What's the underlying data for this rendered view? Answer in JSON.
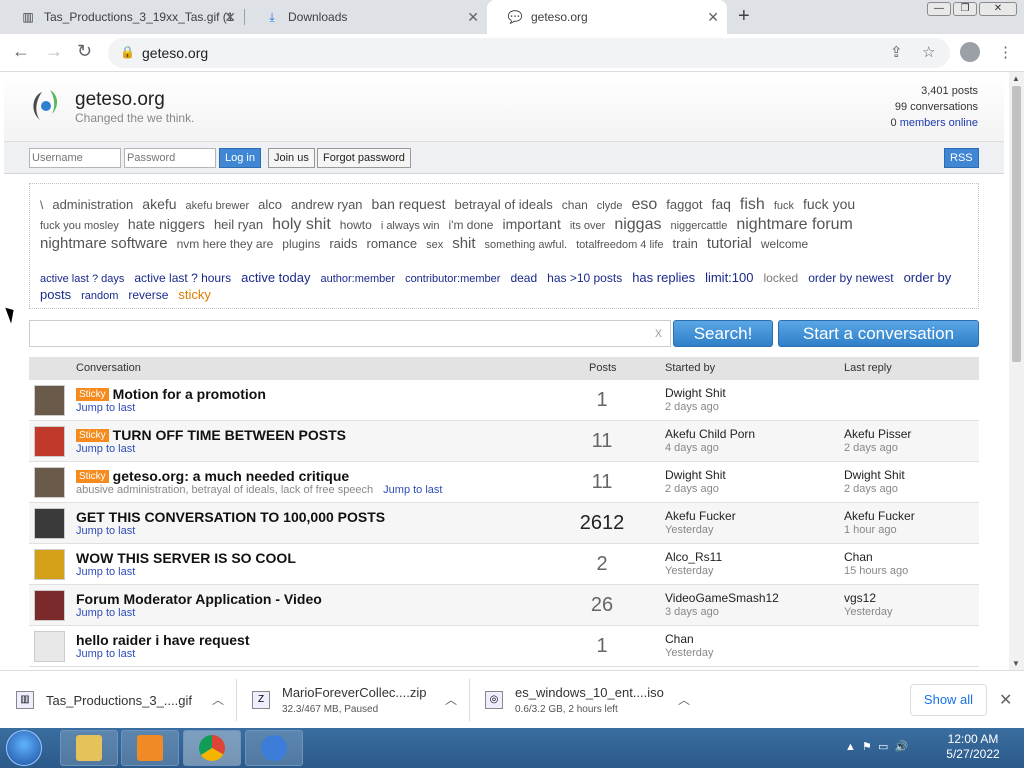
{
  "browser": {
    "tabs": [
      {
        "label": "Tas_Productions_3_19xx_Tas.gif (1",
        "icon": "image-file-icon"
      },
      {
        "label": "Downloads",
        "icon": "download-icon"
      },
      {
        "label": "geteso.org",
        "icon": "chat-icon"
      }
    ],
    "url": "geteso.org",
    "window_controls": {
      "min": "—",
      "max": "❐",
      "close": "✕"
    }
  },
  "forum": {
    "title": "geteso.org",
    "tagline": "Changed the we think.",
    "stats": {
      "posts": "3,401 posts",
      "conversations": "99 conversations",
      "members_count": "0",
      "members_label": "members online"
    },
    "login": {
      "username_placeholder": "Username",
      "password_placeholder": "Password",
      "login_label": "Log in",
      "join_label": "Join us",
      "forgot_label": "Forgot password",
      "rss_label": "RSS"
    },
    "tag_lines": [
      [
        {
          "t": "\\",
          "s": 12
        },
        {
          "t": "administration",
          "s": 13
        },
        {
          "t": "akefu",
          "s": 14
        },
        {
          "t": "akefu brewer",
          "s": 11
        },
        {
          "t": "alco",
          "s": 13
        },
        {
          "t": "andrew ryan",
          "s": 13
        },
        {
          "t": "ban request",
          "s": 14
        },
        {
          "t": "betrayal of ideals",
          "s": 13
        },
        {
          "t": "chan",
          "s": 12
        },
        {
          "t": "clyde",
          "s": 11
        },
        {
          "t": "eso",
          "s": 16
        },
        {
          "t": "faggot",
          "s": 13
        },
        {
          "t": "faq",
          "s": 14
        },
        {
          "t": "fish",
          "s": 16
        },
        {
          "t": "fuck",
          "s": 11
        },
        {
          "t": "fuck you",
          "s": 14
        }
      ],
      [
        {
          "t": "fuck you mosley",
          "s": 11
        },
        {
          "t": "hate niggers",
          "s": 14
        },
        {
          "t": "heil ryan",
          "s": 13
        },
        {
          "t": "holy shit",
          "s": 16
        },
        {
          "t": "howto",
          "s": 12
        },
        {
          "t": "i always win",
          "s": 11
        },
        {
          "t": "i'm done",
          "s": 12
        },
        {
          "t": "important",
          "s": 14
        },
        {
          "t": "its over",
          "s": 11
        },
        {
          "t": "niggas",
          "s": 16
        },
        {
          "t": "niggercattle",
          "s": 11
        },
        {
          "t": "nightmare forum",
          "s": 16
        }
      ],
      [
        {
          "t": "nightmare software",
          "s": 15
        },
        {
          "t": "nvm here they are",
          "s": 12
        },
        {
          "t": "plugins",
          "s": 12
        },
        {
          "t": "raids",
          "s": 13
        },
        {
          "t": "romance",
          "s": 13
        },
        {
          "t": "sex",
          "s": 11
        },
        {
          "t": "shit",
          "s": 15
        },
        {
          "t": "something awful.",
          "s": 11
        },
        {
          "t": "totalfreedom 4 life",
          "s": 11
        },
        {
          "t": "train",
          "s": 13
        },
        {
          "t": "tutorial",
          "s": 15
        },
        {
          "t": "welcome",
          "s": 12
        }
      ]
    ],
    "gadgets": [
      {
        "t": "active last ? days",
        "s": 11,
        "c": "#1a2a8c"
      },
      {
        "t": "active last ? hours",
        "s": 12,
        "c": "#1a2a8c"
      },
      {
        "t": "active today",
        "s": 13,
        "c": "#1a2a8c"
      },
      {
        "t": "author:member",
        "s": 11,
        "c": "#1a2a8c"
      },
      {
        "t": "contributor:member",
        "s": 11,
        "c": "#1a2a8c"
      },
      {
        "t": "dead",
        "s": 12,
        "c": "#1a2a8c"
      },
      {
        "t": "has >10 posts",
        "s": 12,
        "c": "#1a2a8c"
      },
      {
        "t": "has replies",
        "s": 13,
        "c": "#1a2a8c"
      },
      {
        "t": "limit:100",
        "s": 13,
        "c": "#1a2a8c"
      },
      {
        "t": "locked",
        "s": 12,
        "c": "#777777"
      },
      {
        "t": "order by newest",
        "s": 12,
        "c": "#1a2a8c"
      },
      {
        "t": "order by posts",
        "s": 13,
        "c": "#1a2a8c"
      },
      {
        "t": "random",
        "s": 11,
        "c": "#1a2a8c"
      },
      {
        "t": "reverse",
        "s": 12,
        "c": "#1a2a8c"
      },
      {
        "t": "sticky",
        "s": 13,
        "c": "#e07b00"
      }
    ],
    "search": {
      "clear": "x",
      "search_label": "Search!",
      "start_label": "Start a conversation"
    },
    "table": {
      "headers": {
        "conversation": "Conversation",
        "posts": "Posts",
        "started_by": "Started by",
        "last_reply": "Last reply"
      },
      "rows": [
        {
          "sticky": "Sticky",
          "title": "Motion for a promotion",
          "jump": "Jump to last",
          "tags": "",
          "posts": "1",
          "starter": "Dwight Shit",
          "started": "2 days ago",
          "last_user": "",
          "last_time": "",
          "avatar": "#6a5a4a"
        },
        {
          "sticky": "Sticky",
          "title": "TURN OFF TIME BETWEEN POSTS",
          "jump": "Jump to last",
          "tags": "",
          "posts": "11",
          "starter": "Akefu Child Porn",
          "started": "4 days ago",
          "last_user": "Akefu Pisser",
          "last_time": "2 days ago",
          "avatar": "#c0392b"
        },
        {
          "sticky": "Sticky",
          "title": "geteso.org: a much needed critique",
          "jump": "Jump to last",
          "tags": "abusive administration, betrayal of ideals, lack of free speech",
          "posts": "11",
          "starter": "Dwight Shit",
          "started": "2 days ago",
          "last_user": "Dwight Shit",
          "last_time": "2 days ago",
          "avatar": "#6a5a4a"
        },
        {
          "sticky": "",
          "title": "GET THIS CONVERSATION TO 100,000 POSTS",
          "jump": "Jump to last",
          "tags": "",
          "posts": "2612",
          "starter": "Akefu Fucker",
          "started": "Yesterday",
          "last_user": "Akefu Fucker",
          "last_time": "1 hour ago",
          "avatar": "#3a3a3a"
        },
        {
          "sticky": "",
          "title": "WOW THIS SERVER IS SO COOL",
          "jump": "Jump to last",
          "tags": "",
          "posts": "2",
          "starter": "Alco_Rs11",
          "started": "Yesterday",
          "last_user": "Chan",
          "last_time": "15 hours ago",
          "avatar": "#d4a017"
        },
        {
          "sticky": "",
          "title": "Forum Moderator Application - Video",
          "jump": "Jump to last",
          "tags": "",
          "posts": "26",
          "starter": "VideoGameSmash12",
          "started": "3 days ago",
          "last_user": "vgs12",
          "last_time": "Yesterday",
          "avatar": "#7a2a2a"
        },
        {
          "sticky": "",
          "title": "hello raider i have request",
          "jump": "Jump to last",
          "tags": "",
          "posts": "1",
          "starter": "Chan",
          "started": "Yesterday",
          "last_user": "",
          "last_time": "",
          "avatar": "#e8e8e8"
        }
      ]
    }
  },
  "downloads": [
    {
      "name": "Tas_Productions_3_....gif",
      "status": ""
    },
    {
      "name": "MarioForeverCollec....zip",
      "status": "32.3/467 MB, Paused"
    },
    {
      "name": "es_windows_10_ent....iso",
      "status": "0.6/3.2 GB, 2 hours left"
    }
  ],
  "shelf": {
    "show_all": "Show all",
    "close": "✕"
  },
  "taskbar": {
    "time": "12:00 AM",
    "date": "5/27/2022"
  }
}
